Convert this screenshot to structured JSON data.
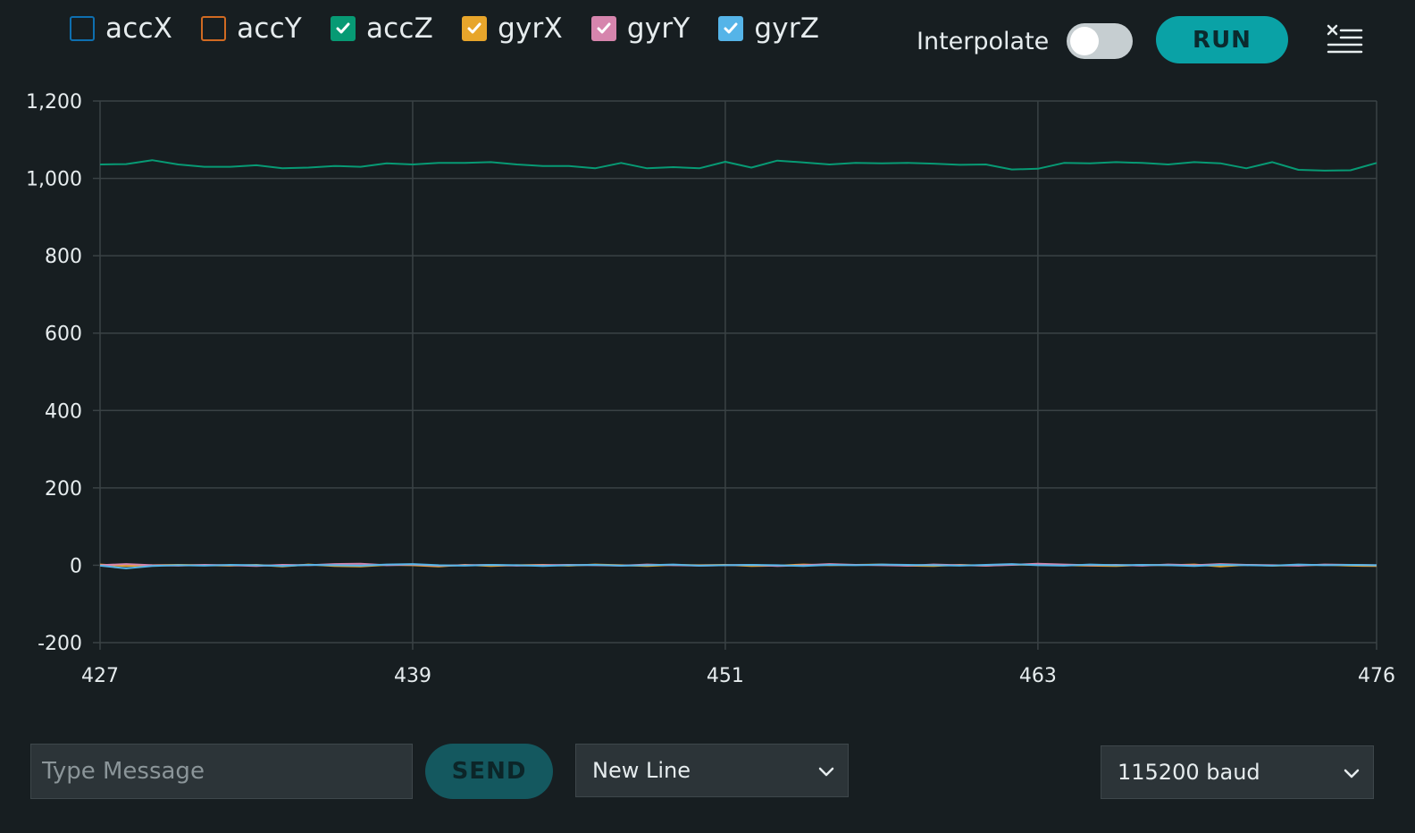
{
  "legend": [
    {
      "label": "accX",
      "color": "#0e6fb0",
      "checked": false
    },
    {
      "label": "accY",
      "color": "#d16a22",
      "checked": false
    },
    {
      "label": "accZ",
      "color": "#079a74",
      "checked": true
    },
    {
      "label": "gyrX",
      "color": "#e7a52b",
      "checked": true
    },
    {
      "label": "gyrY",
      "color": "#d685ad",
      "checked": true
    },
    {
      "label": "gyrZ",
      "color": "#55b4e8",
      "checked": true
    }
  ],
  "toolbar": {
    "interpolate_label": "Interpolate",
    "interpolate_on": false,
    "run_label": "RUN"
  },
  "bottom": {
    "message_placeholder": "Type Message",
    "send_label": "SEND",
    "line_ending": "New Line",
    "baud": "115200 baud"
  },
  "colors": {
    "grid": "#3a4245",
    "accent": "#0aa2a6"
  },
  "chart_data": {
    "type": "line",
    "grid": true,
    "xlim": [
      427,
      476
    ],
    "ylim": [
      -200,
      1200
    ],
    "x_ticks": [
      427,
      439,
      451,
      463,
      476
    ],
    "y_ticks": [
      -200,
      0,
      200,
      400,
      600,
      800,
      1000,
      1200
    ],
    "x_tick_labels": [
      "427",
      "439",
      "451",
      "463",
      "476"
    ],
    "y_tick_labels": [
      "-200",
      "0",
      "200",
      "400",
      "600",
      "800",
      "1,000",
      "1,200"
    ],
    "x": [
      427,
      428,
      429,
      430,
      431,
      432,
      433,
      434,
      435,
      436,
      437,
      438,
      439,
      440,
      441,
      442,
      443,
      444,
      445,
      446,
      447,
      448,
      449,
      450,
      451,
      452,
      453,
      454,
      455,
      456,
      457,
      458,
      459,
      460,
      461,
      462,
      463,
      464,
      465,
      466,
      467,
      468,
      469,
      470,
      471,
      472,
      473,
      474,
      475,
      476
    ],
    "series": [
      {
        "name": "accZ",
        "color": "#079a74",
        "values": [
          1036,
          1037,
          1047,
          1036,
          1030,
          1030,
          1034,
          1026,
          1028,
          1032,
          1030,
          1039,
          1036,
          1040,
          1040,
          1042,
          1036,
          1032,
          1032,
          1026,
          1040,
          1026,
          1029,
          1026,
          1043,
          1028,
          1046,
          1041,
          1036,
          1040,
          1039,
          1040,
          1038,
          1035,
          1036,
          1023,
          1025,
          1040,
          1039,
          1042,
          1040,
          1036,
          1042,
          1039,
          1026,
          1042,
          1022,
          1020,
          1021,
          1040
        ]
      },
      {
        "name": "gyrX",
        "color": "#e7a52b",
        "values": [
          2,
          -2,
          0,
          1,
          0,
          -1,
          1,
          -3,
          2,
          -2,
          -3,
          1,
          0,
          -3,
          1,
          -2,
          0,
          1,
          -1,
          2,
          0,
          -2,
          1,
          0,
          1,
          -2,
          -1,
          2,
          0,
          1,
          2,
          -1,
          -2,
          1,
          -1,
          2,
          1,
          0,
          -1,
          -2,
          1,
          0,
          2,
          -3,
          1,
          -1,
          0,
          1,
          -1,
          -2
        ]
      },
      {
        "name": "gyrY",
        "color": "#d685ad",
        "values": [
          0,
          3,
          0,
          -1,
          1,
          0,
          -2,
          1,
          0,
          3,
          4,
          0,
          2,
          -1,
          0,
          1,
          -1,
          0,
          1,
          0,
          -1,
          2,
          0,
          -1,
          0,
          1,
          -2,
          0,
          3,
          1,
          0,
          -1,
          2,
          0,
          -1,
          1,
          4,
          2,
          0,
          1,
          -1,
          2,
          0,
          3,
          1,
          0,
          -1,
          2,
          1,
          0
        ]
      },
      {
        "name": "gyrZ",
        "color": "#55b4e8",
        "values": [
          -1,
          -8,
          -2,
          0,
          -1,
          1,
          0,
          -2,
          1,
          0,
          -1,
          2,
          3,
          0,
          -1,
          1,
          0,
          -2,
          0,
          1,
          -1,
          0,
          2,
          -1,
          0,
          1,
          0,
          -2,
          1,
          0,
          2,
          1,
          0,
          -1,
          1,
          3,
          0,
          -1,
          2,
          0,
          1,
          0,
          -2,
          1,
          0,
          -1,
          2,
          0,
          1,
          0
        ]
      }
    ]
  }
}
